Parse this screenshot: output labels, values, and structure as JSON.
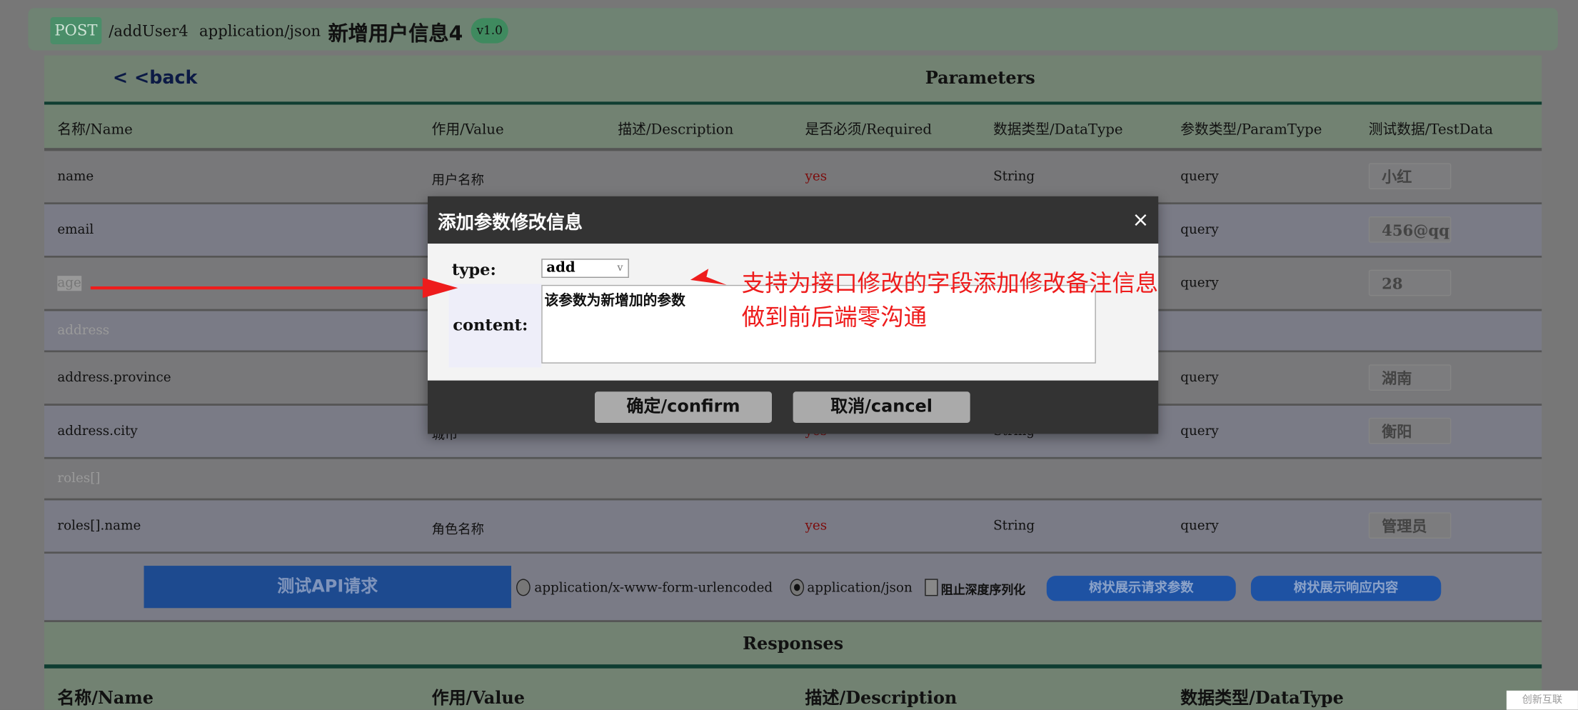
{
  "header": {
    "method": "POST",
    "path": "/addUser4",
    "content_type": "application/json",
    "title": "新增用户信息4",
    "version": "v1.0"
  },
  "parameters": {
    "back_label": "< <back",
    "title": "Parameters",
    "columns": [
      "名称/Name",
      "作用/Value",
      "描述/Description",
      "是否必须/Required",
      "数据类型/DataType",
      "参数类型/ParamType",
      "测试数据/TestData"
    ],
    "rows": [
      {
        "name": "name",
        "value": "用户名称",
        "required": "yes",
        "datatype": "String",
        "paramtype": "query",
        "testdata": "小红"
      },
      {
        "name": "email",
        "value": "",
        "required": "",
        "datatype": "",
        "paramtype": "query",
        "testdata": "456@qq"
      },
      {
        "name": "age",
        "value": "",
        "required": "",
        "datatype": "",
        "paramtype": "query",
        "testdata": "28"
      },
      {
        "name": "address"
      },
      {
        "name": "address.province",
        "value": "",
        "required": "",
        "datatype": "",
        "paramtype": "query",
        "testdata": "湖南"
      },
      {
        "name": "address.city",
        "value": "城市",
        "required": "yes",
        "datatype": "String",
        "paramtype": "query",
        "testdata": "衡阳"
      },
      {
        "name": "roles[]"
      },
      {
        "name": "roles[].name",
        "value": "角色名称",
        "required": "yes",
        "datatype": "String",
        "paramtype": "query",
        "testdata": "管理员"
      }
    ]
  },
  "actions": {
    "test_api": "测试API请求",
    "radio_form": "application/x-www-form-urlencoded",
    "radio_json": "application/json",
    "selected": "application/json",
    "checkbox_no_deep": "阻止深度序列化",
    "tree_request": "树状展示请求参数",
    "tree_response": "树状展示响应内容"
  },
  "responses": {
    "title": "Responses",
    "columns": [
      "名称/Name",
      "作用/Value",
      "描述/Description",
      "数据类型/DataType"
    ]
  },
  "dialog": {
    "title": "添加参数修改信息",
    "close": "×",
    "type_label": "type:",
    "type_value": "add",
    "content_label": "content:",
    "content_value": "该参数为新增加的参数",
    "confirm": "确定/confirm",
    "cancel": "取消/cancel"
  },
  "annotation": {
    "line1": "支持为接口修改的字段添加修改备注信息",
    "line2": "做到前后端零沟通",
    "color": "#ee1c1c"
  },
  "watermark": "创新互联"
}
